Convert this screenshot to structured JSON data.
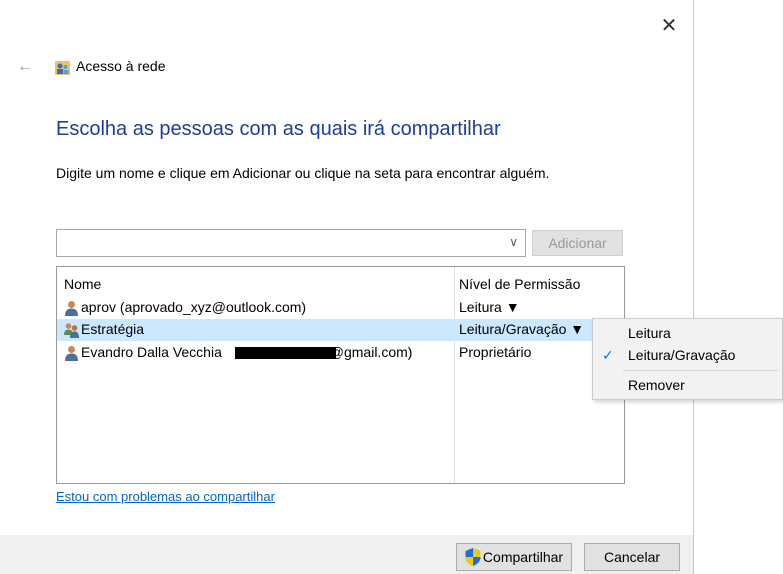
{
  "window": {
    "close_glyph": "✕",
    "back_glyph": "←",
    "title": "Acesso à rede"
  },
  "page": {
    "heading": "Escolha as pessoas com as quais irá compartilhar",
    "instruction": "Digite um nome e clique em Adicionar ou clique na seta para encontrar alguém.",
    "name_input": {
      "value": "",
      "placeholder": ""
    },
    "add_button": "Adicionar",
    "trouble_link": "Estou com problemas ao compartilhar"
  },
  "list": {
    "headers": {
      "name": "Nome",
      "permission": "Nível de Permissão"
    },
    "rows": [
      {
        "name": "aprov (aprovado_xyz@outlook.com)",
        "permission": "Leitura ▼",
        "icon": "user-icon"
      },
      {
        "name": "Estratégia",
        "permission": "Leitura/Gravação ▼",
        "icon": "group-icon",
        "selected": true
      },
      {
        "name": "Evandro Dalla Vecchia ",
        "name_suffix": "@gmail.com)",
        "permission": "Proprietário",
        "icon": "user-icon",
        "redacted": true
      }
    ]
  },
  "context_menu": {
    "items": [
      {
        "label": "Leitura",
        "checked": false
      },
      {
        "label": "Leitura/Gravação",
        "checked": true
      },
      {
        "label": "Remover",
        "checked": false
      }
    ],
    "check_glyph": "✓"
  },
  "footer": {
    "share_button": "Compartilhar",
    "cancel_button": "Cancelar"
  },
  "colors": {
    "heading": "#1f3d99",
    "link": "#0066cc",
    "selection": "#cce8ff",
    "accent": "#0078d7"
  }
}
